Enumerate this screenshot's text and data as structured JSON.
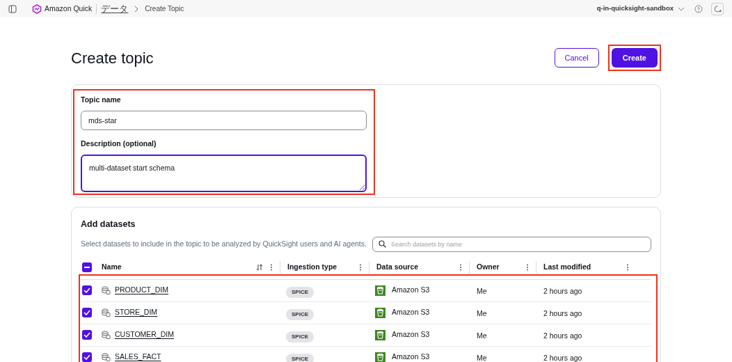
{
  "top_bar": {
    "app_name": "Amazon Quick",
    "breadcrumbs": [
      {
        "label": "データ",
        "link": true
      },
      {
        "label": "Create Topic",
        "link": false
      }
    ],
    "account": "q-in-quicksight-sandbox"
  },
  "page": {
    "title": "Create topic",
    "buttons": [
      {
        "label": "Cancel",
        "kind": "secondary",
        "highlighted": false
      },
      {
        "label": "Create",
        "kind": "primary",
        "highlighted": true
      }
    ]
  },
  "form": {
    "highlighted": true,
    "fields": [
      {
        "label": "Topic name",
        "value": "mds-star",
        "kind": "input",
        "focused": false
      },
      {
        "label": "Description (optional)",
        "value": "multi-dataset start schema",
        "kind": "textarea",
        "focused": true
      }
    ]
  },
  "datasets": {
    "title": "Add datasets",
    "description": "Select datasets to include in the topic to be analyzed by QuickSight users and AI agents.",
    "search": {
      "placeholder": "Search datasets by name"
    },
    "select_all_indeterminate": true,
    "rows_highlighted": true,
    "columns": [
      {
        "label": "Name",
        "sortable": true
      },
      {
        "label": "Ingestion type",
        "sortable": false
      },
      {
        "label": "Data source",
        "sortable": false
      },
      {
        "label": "Owner",
        "sortable": false
      },
      {
        "label": "Last modified",
        "sortable": false
      }
    ],
    "rows": [
      {
        "checked": true,
        "name": "PRODUCT_DIM",
        "ingestion": "SPICE",
        "source": "Amazon S3",
        "owner": "Me",
        "modified": "2 hours ago"
      },
      {
        "checked": true,
        "name": "STORE_DIM",
        "ingestion": "SPICE",
        "source": "Amazon S3",
        "owner": "Me",
        "modified": "2 hours ago"
      },
      {
        "checked": true,
        "name": "CUSTOMER_DIM",
        "ingestion": "SPICE",
        "source": "Amazon S3",
        "owner": "Me",
        "modified": "2 hours ago"
      },
      {
        "checked": true,
        "name": "SALES_FACT",
        "ingestion": "SPICE",
        "source": "Amazon S3",
        "owner": "Me",
        "modified": "2 hours ago"
      }
    ]
  }
}
